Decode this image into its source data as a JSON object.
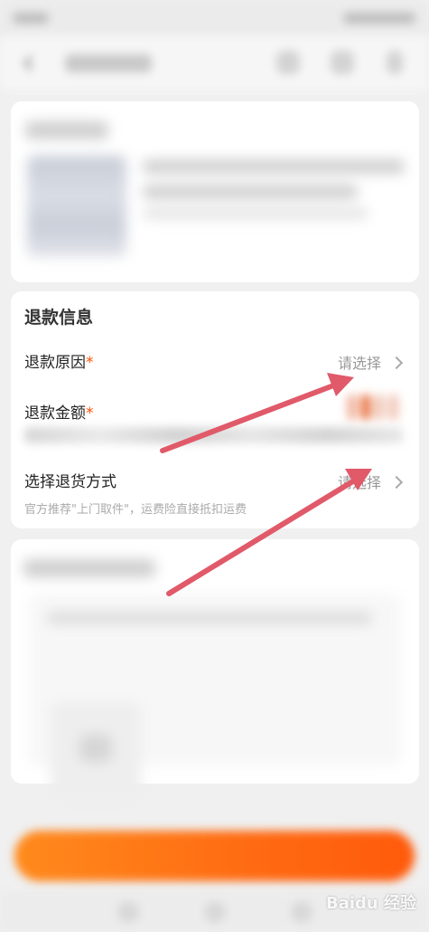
{
  "refund_section": {
    "title": "退款信息",
    "reason": {
      "label": "退款原因",
      "required_mark": "*",
      "value": "请选择"
    },
    "amount": {
      "label": "退款金额",
      "required_mark": "*"
    },
    "return_method": {
      "label": "选择退货方式",
      "value": "请选择",
      "hint": "官方推荐\"上门取件\"，运费险直接抵扣运费"
    }
  },
  "watermark": {
    "text": "Baidu 经验"
  },
  "colors": {
    "accent": "#ff5000",
    "submit_gradient_start": "#ff8a1c",
    "submit_gradient_end": "#ff5a0a",
    "annotation_arrow": "#e05a6a"
  },
  "icons": {
    "back": "chevron-left-icon",
    "row_arrow": "chevron-right-icon"
  }
}
